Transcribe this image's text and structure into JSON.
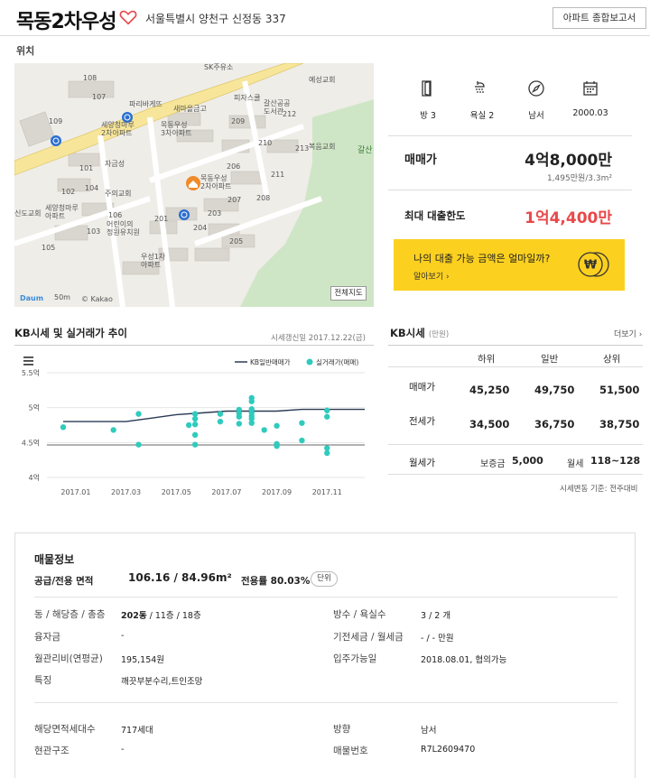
{
  "header": {
    "title": "목동2차우성",
    "address": "서울특별시 양천구 신정동 337",
    "report_button": "아파트 종합보고서"
  },
  "location_label": "위치",
  "map": {
    "full_map_button": "전체지도",
    "logo": "Daum",
    "scale": "50m",
    "copyright": "© Kakao",
    "labels": {
      "apt_seoyang": "세양청마루\n2차아파트",
      "apt_mokdong3": "목동우성\n3차아파트",
      "apt_mokdong2": "목동우성\n2차아파트",
      "apt_seoyang_b": "세양청마루\n아파트",
      "apt_woosung1": "우성1차\n아파트",
      "kindergarten": "어린이의\n정원유치원",
      "church_yesung": "예성교회",
      "church_bokeum": "복음교회",
      "church_ju": "주의교회",
      "church_sin": "신도교회",
      "library": "갈산공공\n도서관",
      "saemaeul": "새마을금고",
      "paris": "파리바게뜨",
      "pizza": "피자스쿨",
      "sk": "SK주유소",
      "galsan": "갈산",
      "jagum": "자금성",
      "pin_num": "2"
    },
    "blocks": [
      "108",
      "109",
      "107",
      "101",
      "102",
      "104",
      "103",
      "105",
      "106",
      "209",
      "212",
      "210",
      "213",
      "206",
      "211",
      "208",
      "207",
      "203",
      "204",
      "201",
      "205",
      "202"
    ]
  },
  "specs": {
    "rooms": "방 3",
    "baths": "욕실 2",
    "direction": "남서",
    "built": "2000.03"
  },
  "price": {
    "label": "매매가",
    "value": "4억8,000만",
    "per_area": "1,495만원/3.3m²",
    "loan_label": "최대 대출한도",
    "loan_value": "1억4,400만"
  },
  "loan_banner": {
    "question": "나의 대출 가능 금액은 얼마일까?",
    "more": "알아보기"
  },
  "trend": {
    "title": "KB시세 및 실거래가 추이",
    "updated": "시세갱신일 2017.12.22(금)"
  },
  "chart_data": {
    "type": "line",
    "title": "KB시세 및 실거래가 추이",
    "y_ticks": [
      "5.5억",
      "5억",
      "4.5억",
      "4억"
    ],
    "ylim": [
      4.0,
      5.5
    ],
    "x_ticks": [
      "2017.01",
      "2017.03",
      "2017.05",
      "2017.07",
      "2017.09",
      "2017.11"
    ],
    "xlim": [
      0,
      12
    ],
    "legend": [
      "KB일반매매가",
      "실거래가(매매)"
    ],
    "legend_placement": "top-right",
    "series": [
      {
        "name": "KB일반매매가",
        "color": "#2b3a55",
        "points": [
          [
            -0.5,
            4.8
          ],
          [
            0,
            4.8
          ],
          [
            1,
            4.8
          ],
          [
            2,
            4.8
          ],
          [
            3,
            4.85
          ],
          [
            4,
            4.9
          ],
          [
            5,
            4.925
          ],
          [
            6,
            4.95
          ],
          [
            7,
            4.95
          ],
          [
            8,
            4.95
          ],
          [
            9,
            4.975
          ],
          [
            10,
            4.975
          ],
          [
            11,
            4.975
          ],
          [
            11.5,
            4.975
          ]
        ]
      },
      {
        "name": "실거래가(매매)",
        "color": "#2fcbbd",
        "points": [
          [
            -0.5,
            4.72
          ],
          [
            1.5,
            4.68
          ],
          [
            2.5,
            4.91
          ],
          [
            2.5,
            4.47
          ],
          [
            4.5,
            4.75
          ],
          [
            4.75,
            4.91
          ],
          [
            4.75,
            4.84
          ],
          [
            4.75,
            4.76
          ],
          [
            4.75,
            4.61
          ],
          [
            4.75,
            4.47
          ],
          [
            5.75,
            4.91
          ],
          [
            5.75,
            4.8
          ],
          [
            6.5,
            4.97
          ],
          [
            6.5,
            4.92
          ],
          [
            6.5,
            4.87
          ],
          [
            6.5,
            4.77
          ],
          [
            7.0,
            5.14
          ],
          [
            7.0,
            5.09
          ],
          [
            7.0,
            4.98
          ],
          [
            7.0,
            4.93
          ],
          [
            7.0,
            4.88
          ],
          [
            7.0,
            4.84
          ],
          [
            7.0,
            4.78
          ],
          [
            7.5,
            4.68
          ],
          [
            8.0,
            4.74
          ],
          [
            8.0,
            4.48
          ],
          [
            8.0,
            4.45
          ],
          [
            9.0,
            4.78
          ],
          [
            9.0,
            4.53
          ],
          [
            10.0,
            4.96
          ],
          [
            10.0,
            4.87
          ],
          [
            10.0,
            4.42
          ],
          [
            10.0,
            4.35
          ]
        ]
      }
    ]
  },
  "kb": {
    "title": "KB시세",
    "unit": "(만원)",
    "more": "더보기",
    "headers": [
      "하위",
      "일반",
      "상위"
    ],
    "sale": {
      "label": "매매가",
      "values": [
        "45,250",
        "49,750",
        "51,500"
      ]
    },
    "jeonse": {
      "label": "전세가",
      "values": [
        "34,500",
        "36,750",
        "38,750"
      ]
    },
    "monthly": {
      "label": "월세가",
      "deposit_label": "보증금",
      "deposit": "5,000",
      "rent_label": "월세",
      "rent": "118~128"
    },
    "footnote": "시세변동 기준: 전주대비"
  },
  "listing": {
    "title": "매물정보",
    "area_label": "공급/전용 면적",
    "area_value": "106.16 / 84.96m²",
    "ratio_label": "전용률 80.03%",
    "unit_button": "단위",
    "fields": {
      "floor_label": "동 / 해당층 / 총층",
      "floor_bold": "202동",
      "floor_rest": " / 11층 / 18층",
      "loan_label": "융자금",
      "loan_value": "-",
      "mgmt_label": "월관리비(연평균)",
      "mgmt_value": "195,154원",
      "feature_label": "특징",
      "feature_value": "깨끗부분수리,트인조망",
      "rooms_label": "방수 / 욕실수",
      "rooms_value": "3 / 2 개",
      "deposit_label": "기전세금 / 월세금",
      "deposit_value": "- / - 만원",
      "movein_label": "입주가능일",
      "movein_value": "2018.08.01, 협의가능",
      "households_label": "해당면적세대수",
      "households_value": "717세대",
      "structure_label": "현관구조",
      "structure_value": "-",
      "direction_label": "방향",
      "direction_value": "남서",
      "number_label": "매물번호",
      "number_value": "R7L2609470"
    }
  }
}
